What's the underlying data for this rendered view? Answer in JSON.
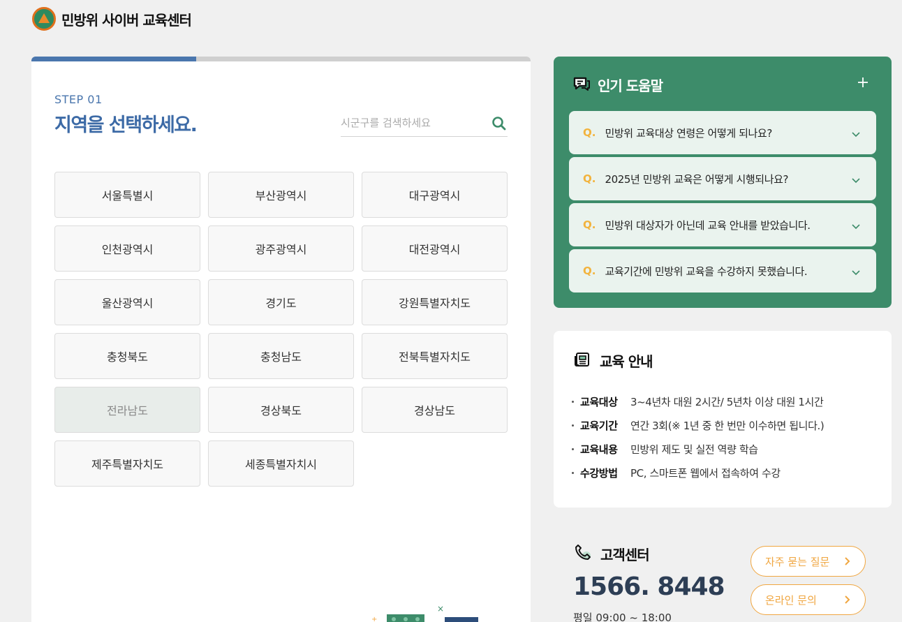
{
  "header": {
    "site_title": "민방위 사이버 교육센터"
  },
  "step": {
    "progress": 0.33,
    "label": "STEP 01",
    "title": "지역을 선택하세요.",
    "search_placeholder": "시군구를 검색하세요",
    "search_value": ""
  },
  "regions": [
    {
      "label": "서울특별시",
      "selected": false
    },
    {
      "label": "부산광역시",
      "selected": false
    },
    {
      "label": "대구광역시",
      "selected": false
    },
    {
      "label": "인천광역시",
      "selected": false
    },
    {
      "label": "광주광역시",
      "selected": false
    },
    {
      "label": "대전광역시",
      "selected": false
    },
    {
      "label": "울산광역시",
      "selected": false
    },
    {
      "label": "경기도",
      "selected": false
    },
    {
      "label": "강원특별자치도",
      "selected": false
    },
    {
      "label": "충청북도",
      "selected": false
    },
    {
      "label": "충청남도",
      "selected": false
    },
    {
      "label": "전북특별자치도",
      "selected": false
    },
    {
      "label": "전라남도",
      "selected": true
    },
    {
      "label": "경상북도",
      "selected": false
    },
    {
      "label": "경상남도",
      "selected": false
    },
    {
      "label": "제주특별자치도",
      "selected": false
    },
    {
      "label": "세종특별자치시",
      "selected": false
    }
  ],
  "faq": {
    "title": "인기 도움말",
    "q_marker": "Q.",
    "items": [
      "민방위 교육대상 연령은 어떻게 되나요?",
      "2025년 민방위 교육은 어떻게 시행되나요?",
      "민방위 대상자가 아닌데 교육 안내를 받았습니다.",
      "교육기간에 민방위 교육을 수강하지 못했습니다."
    ]
  },
  "edu": {
    "title": "교육 안내",
    "rows": [
      {
        "key": "교육대상",
        "value": "3~4년차 대원 2시간/ 5년차 이상 대원 1시간"
      },
      {
        "key": "교육기간",
        "value": "연간 3회(※ 1년 중 한 번만 이수하면 됩니다.)"
      },
      {
        "key": "교육내용",
        "value": "민방위 제도 및 실전 역량 학습"
      },
      {
        "key": "수강방법",
        "value": "PC, 스마트폰 웹에서 접속하여 수강"
      }
    ]
  },
  "customer_center": {
    "title": "고객센터",
    "phone": "1566. 8448",
    "hours": "평일 09:00 ~ 18:00",
    "faq_button": "자주 묻는 질문",
    "inquiry_button": "온라인 문의"
  },
  "colors": {
    "accent_blue": "#4a76ad",
    "faq_green": "#3d8c6a",
    "q_yellow": "#f2b33d",
    "pill_orange": "#f0a640"
  }
}
